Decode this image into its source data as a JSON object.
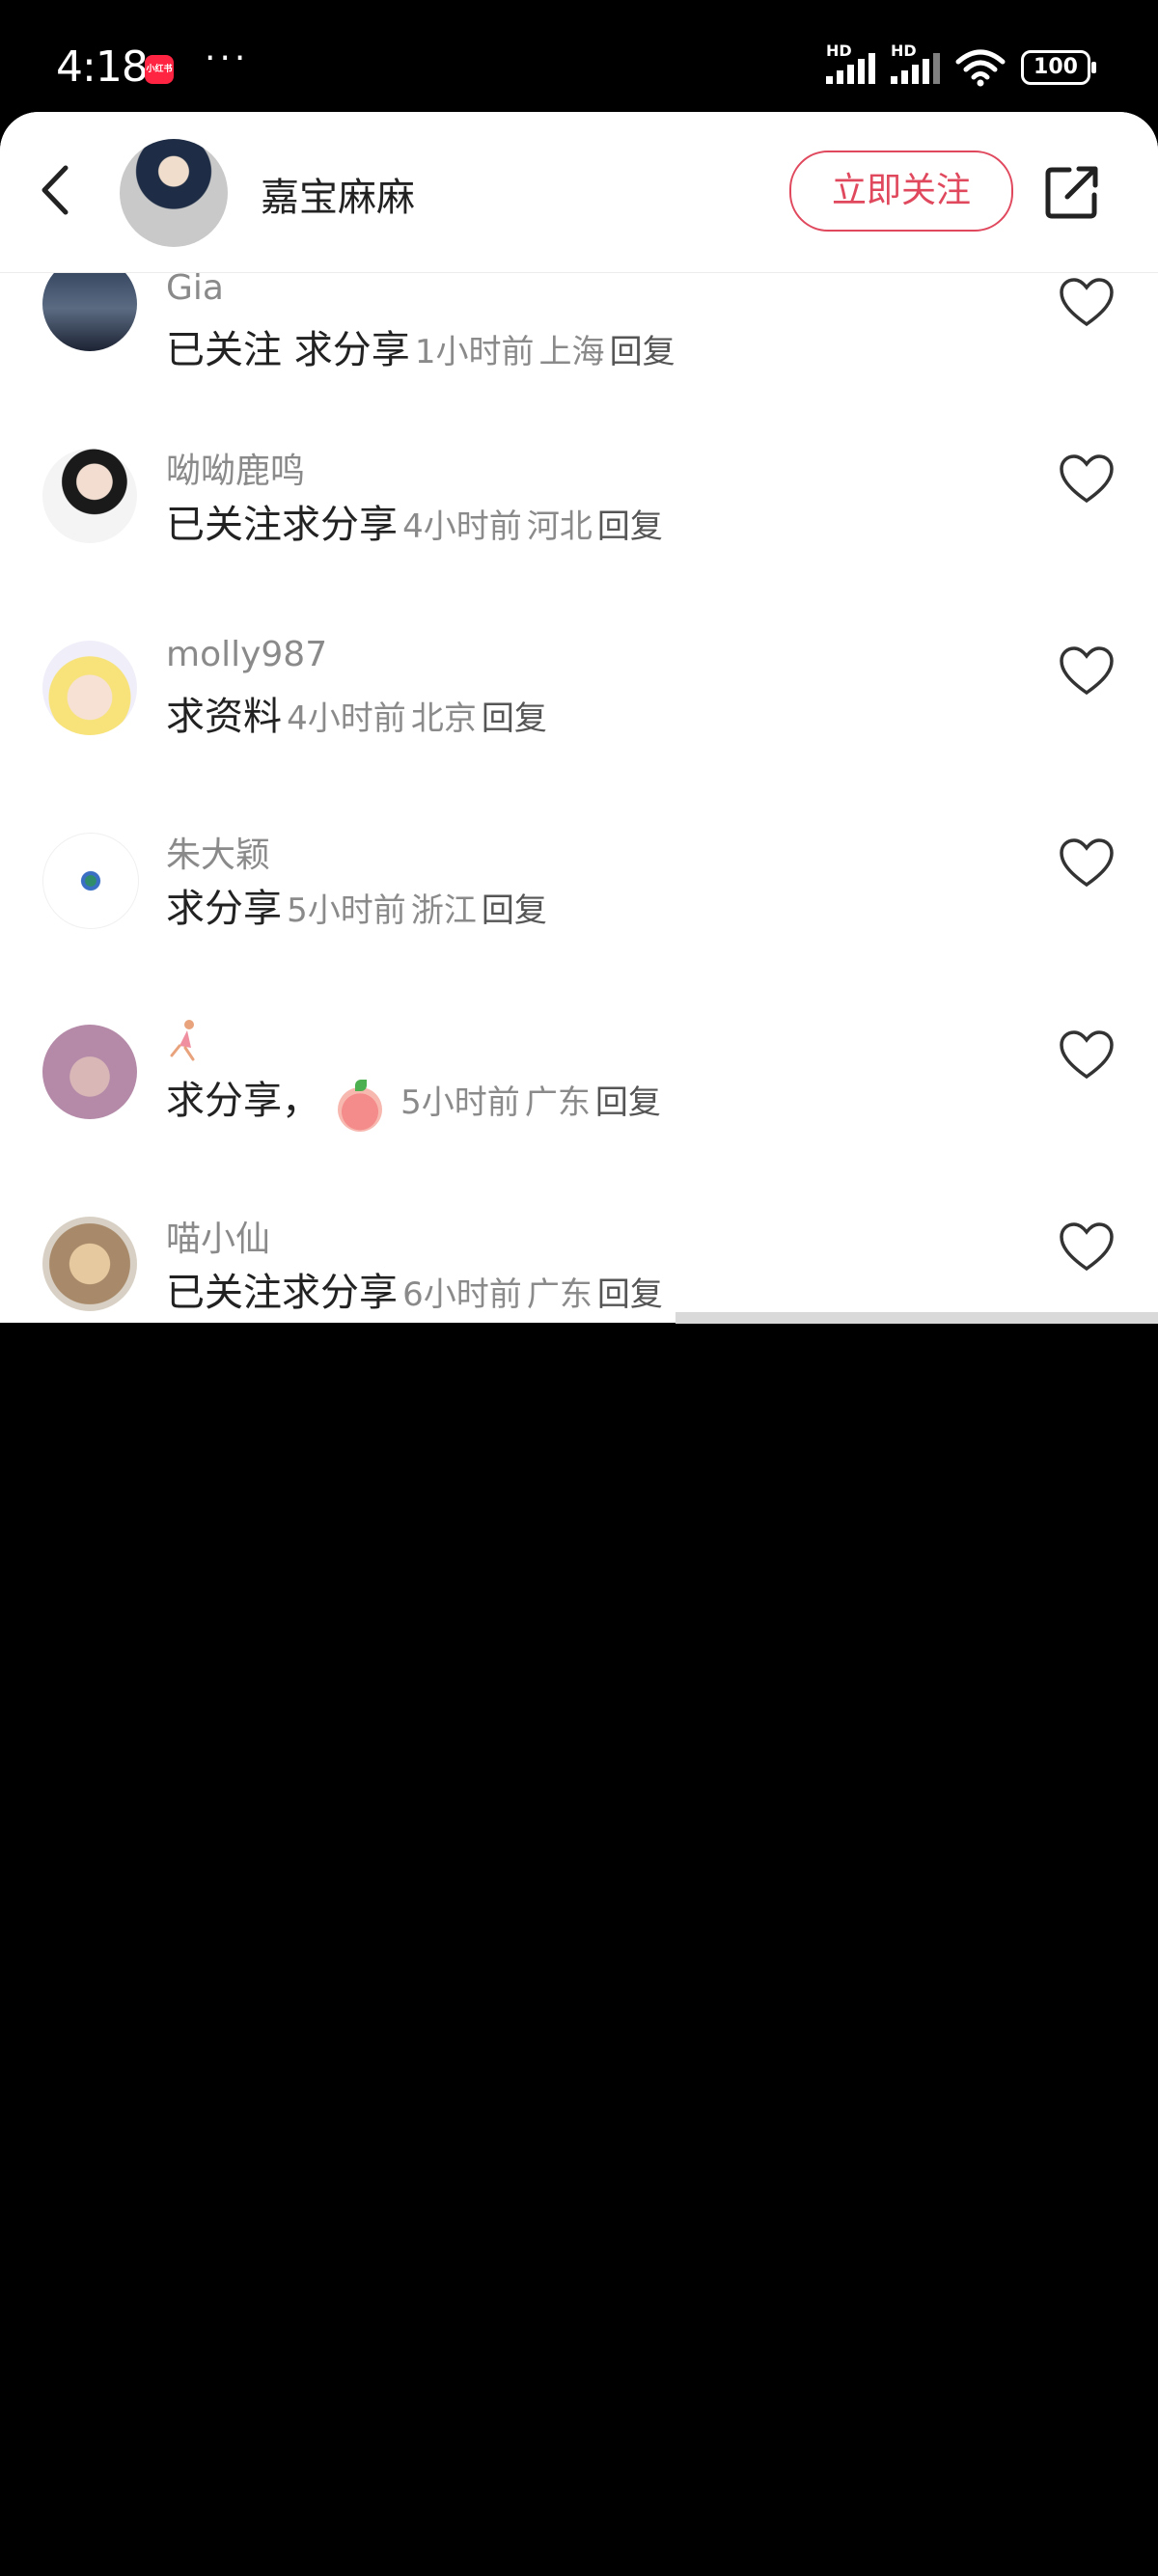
{
  "status_bar": {
    "time": "4:18",
    "app_badge": "小红书",
    "overflow": "···",
    "signal_labels": [
      "HD",
      "HD"
    ],
    "battery": "100"
  },
  "header": {
    "username": "嘉宝麻麻",
    "follow_label": "立即关注",
    "accent_color": "#e0485d"
  },
  "comments": [
    {
      "user": "Gia",
      "text": "已关注 求分享",
      "time": "1小时前",
      "location": "上海",
      "reply": "回复"
    },
    {
      "user": "呦呦鹿鸣",
      "text": "已关注求分享",
      "time": "4小时前",
      "location": "河北",
      "reply": "回复"
    },
    {
      "user": "molly987",
      "text": "求资料",
      "time": "4小时前",
      "location": "北京",
      "reply": "回复"
    },
    {
      "user": "朱大颖",
      "text": "求分享",
      "time": "5小时前",
      "location": "浙江",
      "reply": "回复"
    },
    {
      "user": "",
      "text": "求分享，",
      "time": "5小时前",
      "location": "广东",
      "reply": "回复"
    },
    {
      "user": "喵小仙",
      "text": "已关注求分享",
      "time": "6小时前",
      "location": "广东",
      "reply": "回复"
    }
  ]
}
